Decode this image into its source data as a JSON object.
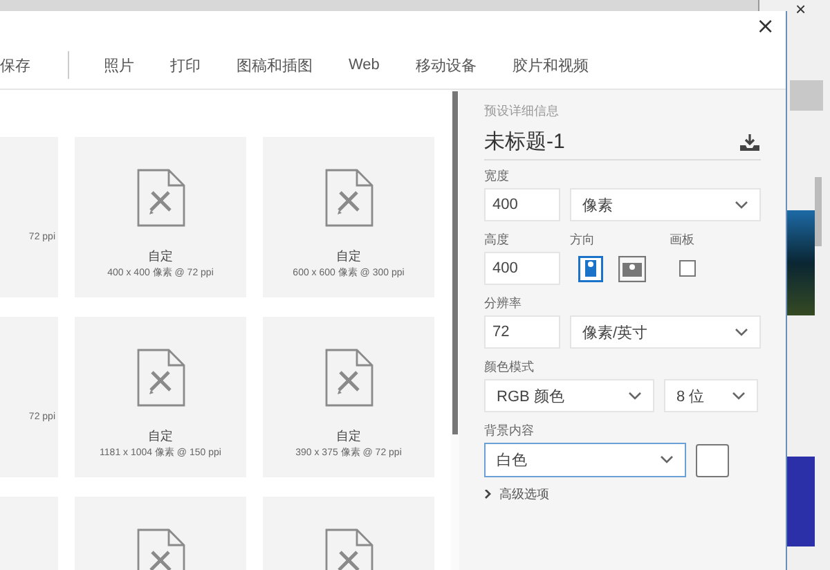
{
  "background_window": {
    "close": "×"
  },
  "window": {
    "close": "×"
  },
  "tabs": [
    {
      "label": "保存",
      "selected": false
    },
    {
      "label": "照片",
      "selected": false
    },
    {
      "label": "打印",
      "selected": false
    },
    {
      "label": "图稿和插图",
      "selected": false
    },
    {
      "label": "Web",
      "selected": false
    },
    {
      "label": "移动设备",
      "selected": false
    },
    {
      "label": "胶片和视频",
      "selected": false
    }
  ],
  "presets": [
    {
      "kind": "partial",
      "sub": "72 ppi"
    },
    {
      "kind": "full",
      "title": "自定",
      "sub": "400 x 400 像素 @ 72 ppi"
    },
    {
      "kind": "full",
      "title": "自定",
      "sub": "600 x 600 像素 @ 300 ppi"
    },
    {
      "kind": "partial",
      "sub": "72 ppi"
    },
    {
      "kind": "full",
      "title": "自定",
      "sub": "1181 x 1004 像素 @ 150 ppi"
    },
    {
      "kind": "full",
      "title": "自定",
      "sub": "390 x 375 像素 @ 72 ppi"
    },
    {
      "kind": "partial"
    },
    {
      "kind": "full"
    },
    {
      "kind": "full"
    }
  ],
  "details": {
    "heading": "预设详细信息",
    "name": "未标题-1",
    "width": {
      "label": "宽度",
      "value": "400",
      "unit": "像素"
    },
    "height": {
      "label": "高度",
      "value": "400"
    },
    "orientation": {
      "label": "方向",
      "options": [
        {
          "kind": "portrait",
          "selected": true
        },
        {
          "kind": "landscape",
          "selected": false
        }
      ]
    },
    "artboard": {
      "label": "画板",
      "checked": false
    },
    "resolution": {
      "label": "分辨率",
      "value": "72",
      "unit": "像素/英寸"
    },
    "color_mode": {
      "label": "颜色模式",
      "mode": "RGB 颜色",
      "depth": "8 位"
    },
    "background": {
      "label": "背景内容",
      "value": "白色",
      "focused": true
    },
    "advanced": {
      "label": "高级选项",
      "expanded": false
    }
  }
}
